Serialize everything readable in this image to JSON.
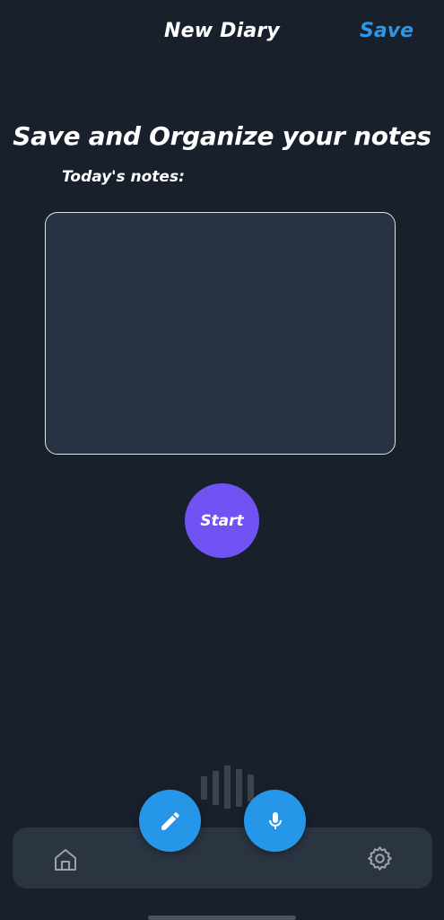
{
  "header": {
    "title": "New Diary",
    "save_label": "Save"
  },
  "main": {
    "headline": "Save and Organize your notes",
    "notes_label": "Today's notes:",
    "notes_value": "",
    "start_label": "Start"
  },
  "fabs": {
    "edit_icon": "pencil-icon",
    "mic_icon": "microphone-icon"
  },
  "bottom_nav": {
    "home_icon": "home-icon",
    "settings_icon": "gear-icon"
  },
  "colors": {
    "background": "#18202b",
    "accent_blue": "#2697e8",
    "save_blue": "#2e96e6",
    "start_purple": "#7152f3",
    "panel": "#273242",
    "nav_bar": "#2b3542"
  }
}
